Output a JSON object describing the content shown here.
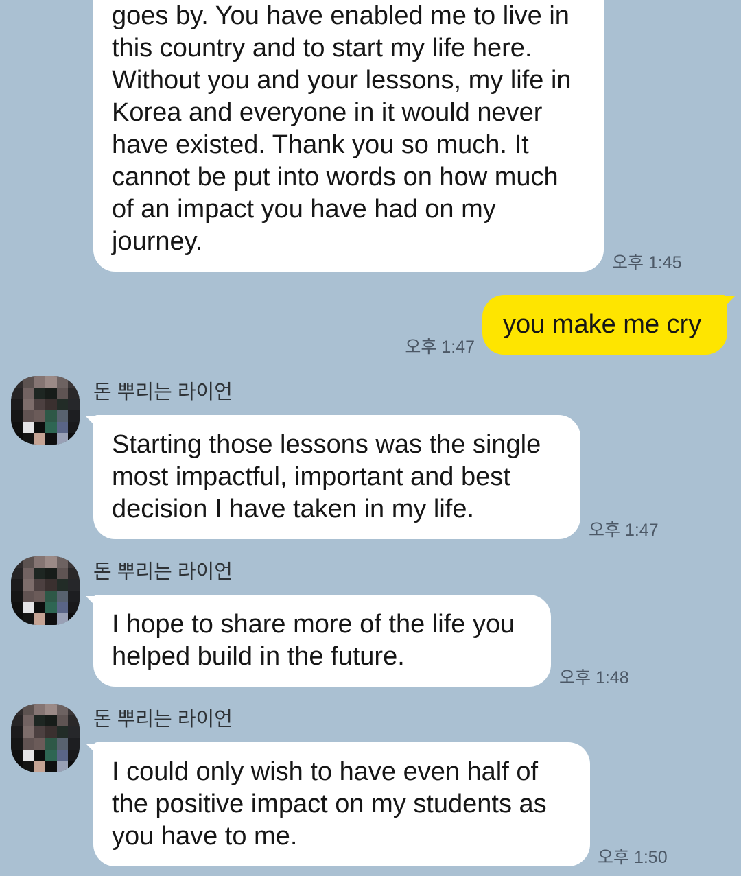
{
  "colors": {
    "background": "#aac0d2",
    "incoming_bubble": "#ffffff",
    "outgoing_bubble": "#fee500",
    "message_text": "#161616",
    "timestamp": "#4c5866",
    "sender_name": "#2e3236"
  },
  "contact": {
    "avatar_mosaic": [
      "#2f2b2c",
      "#5c5250",
      "#857573",
      "#9b8a87",
      "#6d6261",
      "#3b3637",
      "#262425",
      "#726362",
      "#1e2622",
      "#171c19",
      "#5f5453",
      "#2a2829",
      "#1c1b1c",
      "#7d6d6b",
      "#4c4040",
      "#3a302f",
      "#222c27",
      "#26272a",
      "#161616",
      "#615352",
      "#6b5b59",
      "#2e5847",
      "#58626f",
      "#1d1e21",
      "#101010",
      "#e4e4e6",
      "#0d0e0e",
      "#2e6653",
      "#5a6587",
      "#19191b",
      "#0b0b0b",
      "#141414",
      "#c4a394",
      "#0f0f10",
      "#99a0b5",
      "#0e0e0f"
    ]
  },
  "messages": [
    {
      "outgoing": false,
      "text": "goes by. You have enabled me to live in\nthis country and to start my life here.\nWithout you and your lessons, my life in\nKorea and everyone in it would never\nhave existed. Thank you so much. It\ncannot be put into words on how much\nof an impact you have had on my\njourney.",
      "time": "오후 1:45"
    },
    {
      "outgoing": true,
      "text": "you make me cry",
      "time": "오후 1:47"
    },
    {
      "outgoing": false,
      "sender": "돈 뿌리는 라이언",
      "text": "Starting those lessons was the single\nmost impactful, important and best\ndecision I have taken in my life.",
      "time": "오후 1:47"
    },
    {
      "outgoing": false,
      "sender": "돈 뿌리는 라이언",
      "text": "I hope to share more of the life you\nhelped build in the future.",
      "time": "오후 1:48"
    },
    {
      "outgoing": false,
      "sender": "돈 뿌리는 라이언",
      "text": "I could only wish to have even half of\nthe positive impact on my students as\nyou have to me.",
      "time": "오후 1:50"
    }
  ]
}
